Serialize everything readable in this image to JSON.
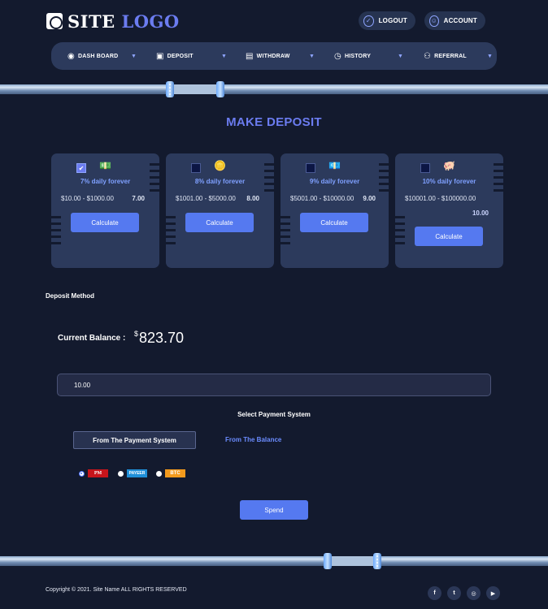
{
  "header": {
    "logo": {
      "word1": "SITE",
      "word2": "LOGO"
    },
    "logout_label": "LOGOUT",
    "account_label": "ACCOUNT"
  },
  "nav": {
    "items": [
      {
        "label": "DASH BOARD",
        "icon": "eye-icon"
      },
      {
        "label": "DEPOSIT",
        "icon": "wallet-icon"
      },
      {
        "label": "WITHDRAW",
        "icon": "cash-icon"
      },
      {
        "label": "HISTORY",
        "icon": "clock-icon"
      },
      {
        "label": "REFERRAL",
        "icon": "people-icon"
      }
    ]
  },
  "page_title": "MAKE DEPOSIT",
  "plans": [
    {
      "rate": "7% daily forever",
      "range": "$10.00 - $1000.00",
      "value": "7.00",
      "selected": true
    },
    {
      "rate": "8% daily forever",
      "range": "$1001.00 - $5000.00",
      "value": "8.00",
      "selected": false
    },
    {
      "rate": "9% daily forever",
      "range": "$5001.00 - $10000.00",
      "value": "9.00",
      "selected": false
    },
    {
      "rate": "10% daily forever",
      "range": "$10001.00 - $100000.00",
      "value": "10.00",
      "selected": false
    }
  ],
  "calculate_label": "Calculate",
  "deposit": {
    "section_label": "Deposit Method",
    "balance_label": "Current Balance :",
    "balance_currency": "$",
    "balance_value": "823.70",
    "amount_value": "10.00",
    "select_title": "Select Payment System",
    "tab_payment_system": "From The Payment System",
    "tab_balance": "From The Balance",
    "payment_options": [
      {
        "label": "PM",
        "selected": true
      },
      {
        "label": "PAYEER",
        "selected": false
      },
      {
        "label": "BTC",
        "selected": false
      }
    ],
    "spend_label": "Spend"
  },
  "footer": {
    "copyright": "Copyright © 2021. Site Name ALL RIGHTS RESERVED",
    "social": [
      {
        "icon": "facebook-icon",
        "glyph": "f"
      },
      {
        "icon": "twitter-icon",
        "glyph": "t"
      },
      {
        "icon": "instagram-icon",
        "glyph": "◎"
      },
      {
        "icon": "youtube-icon",
        "glyph": "▶"
      }
    ]
  },
  "colors": {
    "background": "#131a2e",
    "panel": "#2c3a5c",
    "accent": "#6b7cf0",
    "button": "#5579f0"
  }
}
